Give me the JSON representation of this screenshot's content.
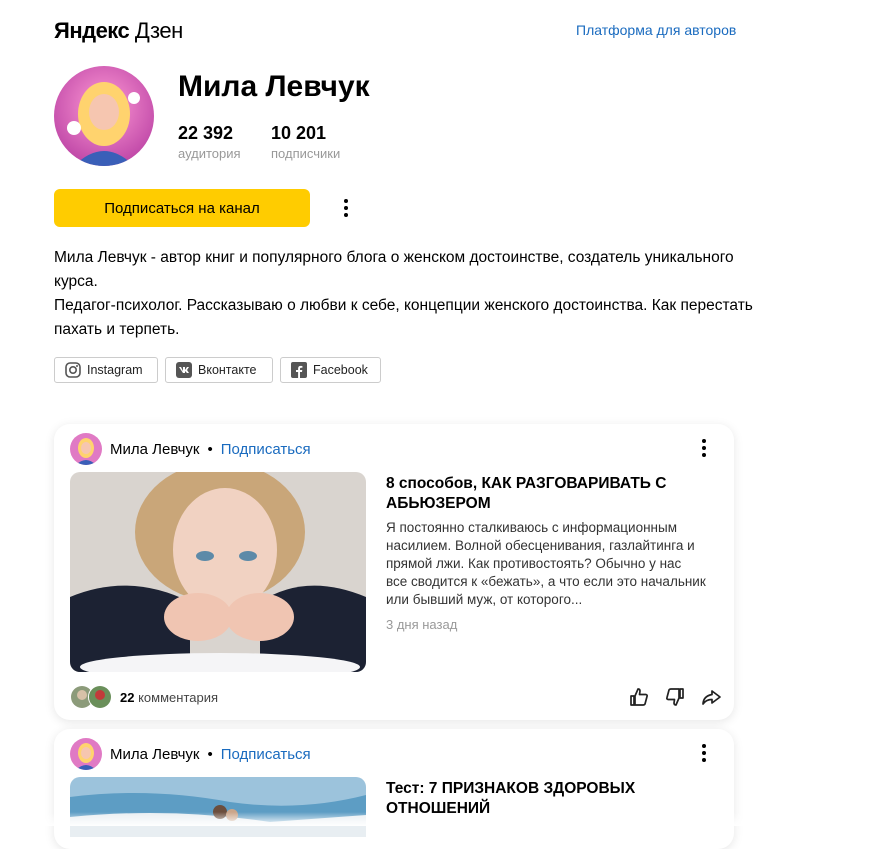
{
  "header": {
    "logo_part1": "Яндекс",
    "logo_part2": "Дзен",
    "platform_link": "Платформа для авторов"
  },
  "channel": {
    "name": "Мила Левчук",
    "stats": [
      {
        "value": "22 392",
        "label": "аудитория"
      },
      {
        "value": "10 201",
        "label": "подписчики"
      }
    ],
    "subscribe_label": "Подписаться на канал",
    "description": [
      "Мила Левчук - автор книг и популярного блога о женском достоинстве, создатель уникального курса.",
      "Педагог-психолог. Рассказываю о любви к себе, концепции женского достоинства. Как перестать пахать и терпеть."
    ],
    "social": [
      {
        "label": "Instagram",
        "icon": "instagram-icon"
      },
      {
        "label": "Вконтакте",
        "icon": "vk-icon"
      },
      {
        "label": "Facebook",
        "icon": "facebook-icon"
      }
    ]
  },
  "feed": [
    {
      "author": "Мила Левчук",
      "separator": "•",
      "subscribe": "Подписаться",
      "title": "8 способов, КАК РАЗГОВАРИВАТЬ С АБЬЮЗЕРОМ",
      "snippet": "Я постоянно сталкиваюсь с информационным насилием. Волной обесценивания, газлайтинга и прямой лжи. Как противостоять?     Обычно у нас все сводится к «бежать», а что если это начальник или бывший муж, от которого...",
      "date": "3 дня назад",
      "comments_count": "22",
      "comments_label": "комментария"
    },
    {
      "author": "Мила Левчук",
      "separator": "•",
      "subscribe": "Подписаться",
      "title": "Тест: 7 ПРИЗНАКОВ ЗДОРОВЫХ ОТНОШЕНИЙ"
    }
  ],
  "colors": {
    "accent_yellow": "#ffcc00",
    "link_blue": "#1a6bbf",
    "muted_text": "#999999"
  }
}
